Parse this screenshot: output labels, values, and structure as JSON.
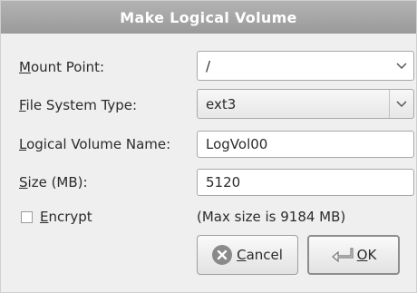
{
  "dialog": {
    "title": "Make Logical Volume"
  },
  "form": {
    "mount_point": {
      "label_mn": "M",
      "label_rest": "ount Point:",
      "value": "/"
    },
    "fs_type": {
      "label_mn": "F",
      "label_rest": "ile System Type:",
      "value": "ext3"
    },
    "lv_name": {
      "label_mn": "L",
      "label_rest": "ogical Volume Name:",
      "value": "LogVol00"
    },
    "size": {
      "label_mn": "S",
      "label_rest": "ize (MB):",
      "value": "5120"
    },
    "encrypt": {
      "label_mn": "E",
      "label_rest": "ncrypt",
      "checked": false
    },
    "max_size_text": "(Max size is 9184 MB)"
  },
  "buttons": {
    "cancel": {
      "label_mn": "C",
      "label_rest": "ancel"
    },
    "ok": {
      "label_mn": "O",
      "label_rest": "K"
    }
  },
  "icons": {
    "dropdown": "chevron-down-icon",
    "cancel": "cancel-circle-icon",
    "ok": "ok-arrow-icon"
  }
}
